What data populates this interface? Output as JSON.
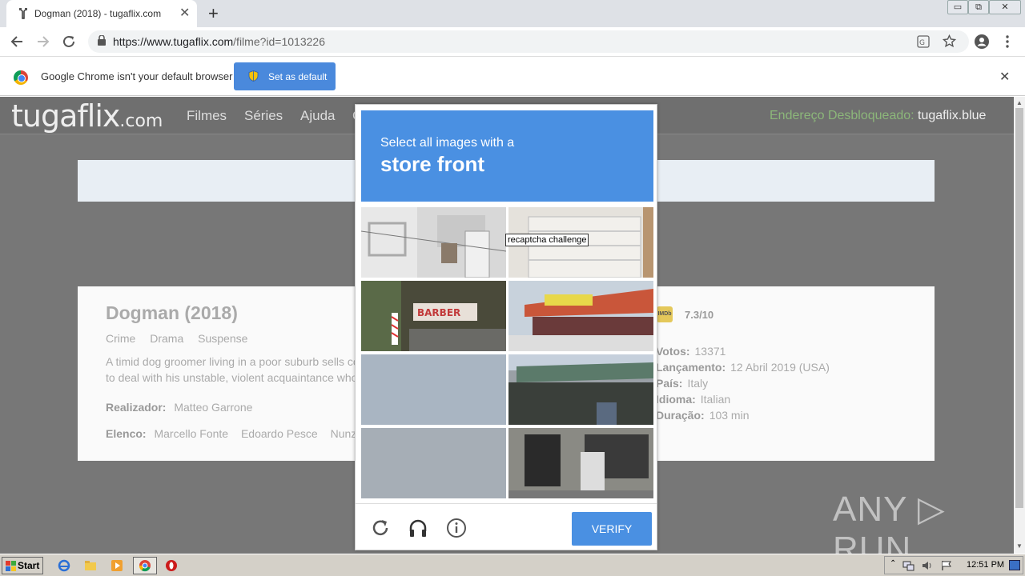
{
  "browser": {
    "tab": {
      "title": "Dogman (2018) - tugaflix.com",
      "close": "✕"
    },
    "new_tab": "+",
    "window_controls": [
      "▭",
      "⧉",
      "✕"
    ],
    "url_host": "https://www.tugaflix.com",
    "url_path": "/filme?id=1013226",
    "icons": [
      "back-icon",
      "forward-icon",
      "reload-icon",
      "lock-icon",
      "translate-icon",
      "star-icon",
      "account-icon",
      "menu-icon"
    ]
  },
  "infobar": {
    "message": "Google Chrome isn't your default browser",
    "button": "Set as default",
    "close": "✕"
  },
  "site": {
    "logo_main": "tugaflix",
    "logo_suffix": ".com",
    "nav": [
      "Filmes",
      "Séries",
      "Ajuda",
      "C"
    ],
    "unblocked_label": "Endereço Desbloqueado:",
    "unblocked_value": "tugaflix.blue"
  },
  "movie": {
    "title": "Dogman (2018)",
    "genres": [
      "Crime",
      "Drama",
      "Suspense"
    ],
    "synopsis_line1": "A timid dog groomer living in a poor suburb sells co",
    "synopsis_line2": "to deal with his unstable, violent acquaintance who",
    "director_label": "Realizador:",
    "director": "Matteo Garrone",
    "cast_label": "Elenco:",
    "cast": [
      "Marcello Fonte",
      "Edoardo Pesce",
      "Nunzia"
    ],
    "imdb_badge": "IMDb",
    "rating": "7.3/10",
    "votes_label": "Votos:",
    "votes": "13371",
    "release_label": "Lançamento:",
    "release": "12 Abril 2019 (USA)",
    "country_label": "País:",
    "country": "Italy",
    "language_label": "Idioma:",
    "language": "Italian",
    "duration_label": "Duração:",
    "duration": "103 min"
  },
  "captcha": {
    "line1": "Select all images with a",
    "line2": "store front",
    "tooltip": "recaptcha challenge",
    "tiles": [
      "white building balcony",
      "garage door",
      "barber shop sign",
      "red tiled roof shop",
      "grey sky",
      "awning storefront",
      "grey sky",
      "shop window"
    ],
    "verify": "VERIFY"
  },
  "watermark": "ANY ▷ RUN",
  "taskbar": {
    "start": "Start",
    "clock": "12:51 PM"
  },
  "colors": {
    "accent": "#4a90e2",
    "overlay": "#777777",
    "unblocked": "#8cb77a"
  }
}
